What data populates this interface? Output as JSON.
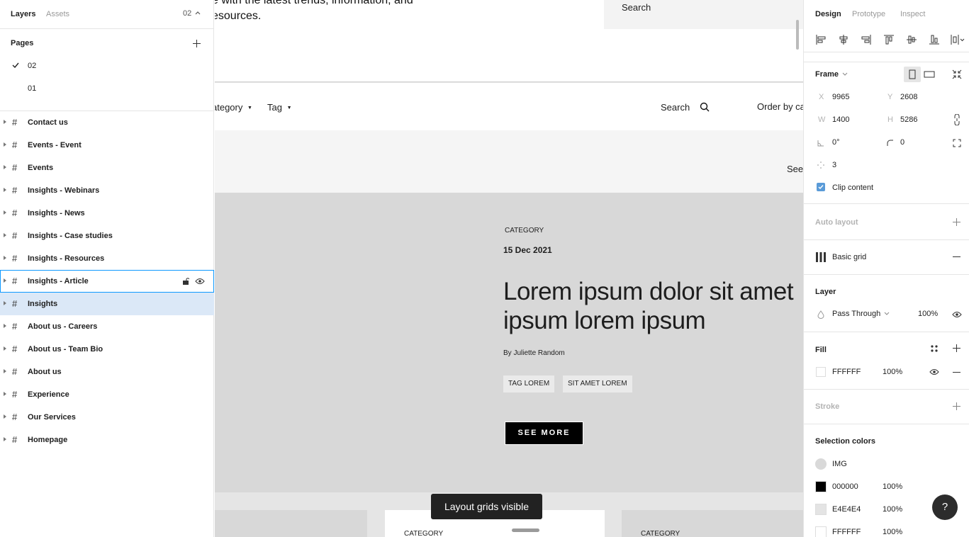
{
  "left_panel": {
    "tabs": {
      "layers": "Layers",
      "assets": "Assets"
    },
    "current_page": "02",
    "pages_title": "Pages",
    "pages": [
      {
        "label": "02",
        "selected": true
      },
      {
        "label": "01",
        "selected": false
      }
    ],
    "layers": [
      {
        "label": "Contact us"
      },
      {
        "label": "Events - Event"
      },
      {
        "label": "Events"
      },
      {
        "label": "Insights - Webinars"
      },
      {
        "label": "Insights - News"
      },
      {
        "label": "Insights - Case studies"
      },
      {
        "label": "Insights - Resources"
      },
      {
        "label": "Insights - Article",
        "state": "hover"
      },
      {
        "label": "Insights",
        "state": "selected"
      },
      {
        "label": "About us - Careers"
      },
      {
        "label": "About us - Team Bio"
      },
      {
        "label": "About us"
      },
      {
        "label": "Experience"
      },
      {
        "label": "Our Services"
      },
      {
        "label": "Homepage"
      }
    ]
  },
  "canvas": {
    "intro_line1": "e with the latest trends, information, and",
    "intro_line2": "esources.",
    "search_box_label": "Search",
    "filter_category": "ategory",
    "filter_tag": "Tag",
    "filter_search": "Search",
    "order_by": "Order by ca",
    "see_link": "See",
    "hero": {
      "category": "CATEGORY",
      "date": "15 Dec 2021",
      "title_line1": "Lorem ipsum dolor sit amet",
      "title_line2": "ipsum lorem ipsum",
      "author": "By Juliette Random",
      "tags": [
        "TAG LOREM",
        "SIT AMET LOREM"
      ],
      "cta": "SEE MORE"
    },
    "card_category_1": "CATEGORY",
    "card_category_2": "CATEGORY",
    "toast": "Layout grids visible"
  },
  "right_panel": {
    "tabs": {
      "design": "Design",
      "prototype": "Prototype",
      "inspect": "Inspect"
    },
    "frame_label": "Frame",
    "x_label": "X",
    "x": "9965",
    "y_label": "Y",
    "y": "2608",
    "w_label": "W",
    "w": "1400",
    "h_label": "H",
    "h": "5286",
    "rotation": "0°",
    "radius": "0",
    "corner_smoothing": "3",
    "clip_content": "Clip content",
    "auto_layout": "Auto layout",
    "basic_grid": "Basic grid",
    "layer_title": "Layer",
    "blend_mode": "Pass Through",
    "layer_opacity": "100%",
    "fill_title": "Fill",
    "fill_hex": "FFFFFF",
    "fill_opacity": "100%",
    "stroke_title": "Stroke",
    "selection_colors_title": "Selection colors",
    "selection_colors": [
      {
        "label": "IMG",
        "color": "#d9d9d9",
        "opacity": ""
      },
      {
        "label": "000000",
        "color": "#000000",
        "opacity": "100%"
      },
      {
        "label": "E4E4E4",
        "color": "#e4e4e4",
        "opacity": "100%"
      },
      {
        "label": "FFFFFF",
        "color": "#ffffff",
        "opacity": "100%"
      }
    ],
    "help": "?"
  },
  "colors": {
    "accent": "#0d99ff",
    "selection_bg": "#dbe8f7",
    "checkbox": "#5a9bd8"
  }
}
